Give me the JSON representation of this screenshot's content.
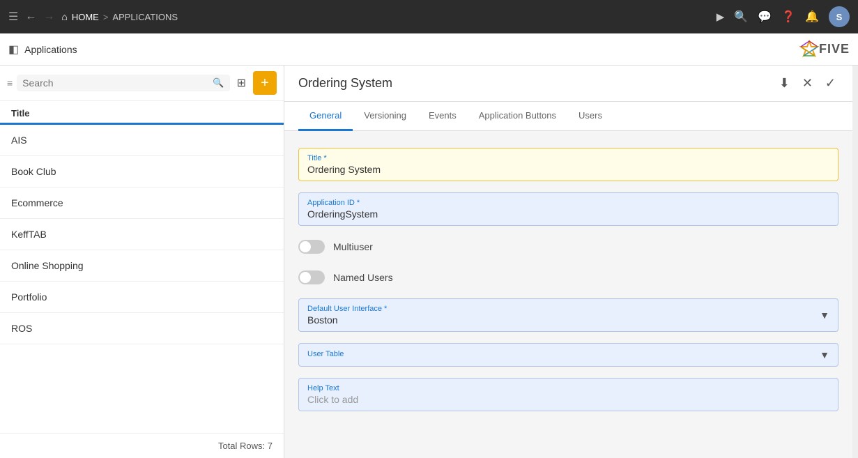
{
  "topbar": {
    "home_label": "HOME",
    "separator": ">",
    "apps_label": "APPLICATIONS",
    "avatar_letter": "S"
  },
  "second_bar": {
    "app_title": "Applications",
    "logo_text": "FIVE"
  },
  "sidebar": {
    "search_placeholder": "Search",
    "column_header": "Title",
    "items": [
      {
        "label": "AIS"
      },
      {
        "label": "Book Club"
      },
      {
        "label": "Ecommerce"
      },
      {
        "label": "KeffTAB"
      },
      {
        "label": "Online Shopping"
      },
      {
        "label": "Portfolio"
      },
      {
        "label": "ROS"
      }
    ],
    "total_rows_label": "Total Rows: 7"
  },
  "detail": {
    "title": "Ordering System",
    "tabs": [
      {
        "label": "General",
        "active": true
      },
      {
        "label": "Versioning",
        "active": false
      },
      {
        "label": "Events",
        "active": false
      },
      {
        "label": "Application Buttons",
        "active": false
      },
      {
        "label": "Users",
        "active": false
      }
    ],
    "form": {
      "title_label": "Title *",
      "title_value": "Ordering System",
      "app_id_label": "Application ID *",
      "app_id_value": "OrderingSystem",
      "multiuser_label": "Multiuser",
      "named_users_label": "Named Users",
      "default_ui_label": "Default User Interface *",
      "default_ui_value": "Boston",
      "user_table_label": "User Table",
      "user_table_value": "",
      "help_text_label": "Help Text",
      "help_text_placeholder": "Click to add"
    }
  }
}
